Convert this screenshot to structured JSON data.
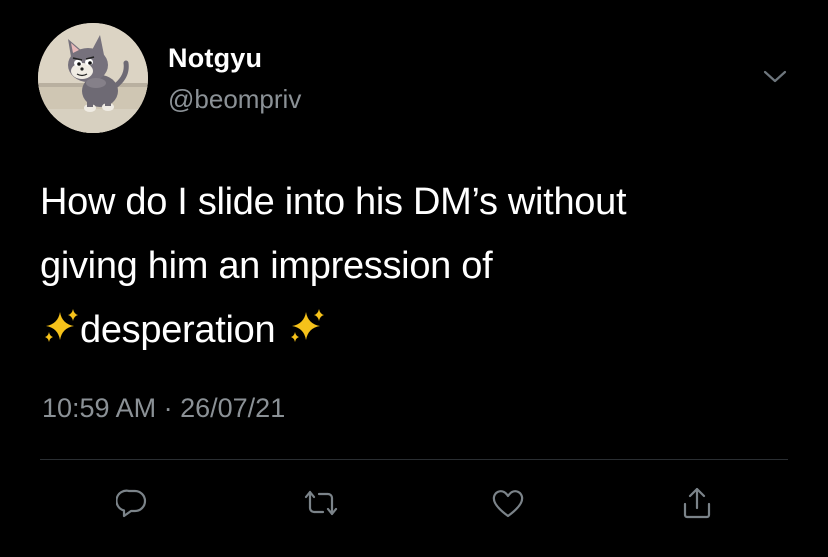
{
  "tweet": {
    "author": {
      "display_name": "Notgyu",
      "handle": "@beompriv",
      "avatar_icon": "cartoon-cat-avatar"
    },
    "text_lines": [
      "How do I slide into his DM’s without",
      "giving him an impression of",
      "desperation"
    ],
    "emoji": "sparkles",
    "time": "10:59 AM",
    "separator": "·",
    "date": "26/07/21",
    "actions": [
      "reply-icon",
      "retweet-icon",
      "like-icon",
      "share-icon"
    ]
  },
  "colors": {
    "background": "#000000",
    "primary_text": "#ffffff",
    "secondary_text": "#8b9196",
    "divider": "#2a2e32",
    "sparkle": "#f6c21a"
  }
}
